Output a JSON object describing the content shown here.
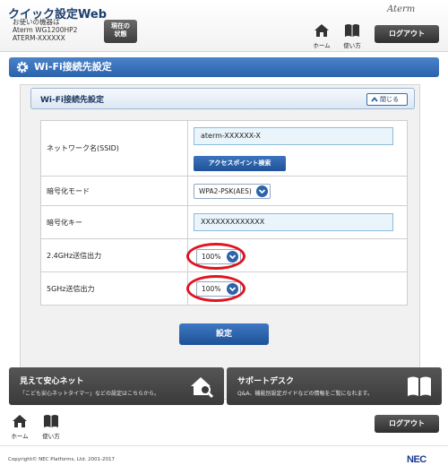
{
  "header": {
    "app_title": "クイック設定Web",
    "device_caption": "お使いの機器は",
    "device_model": "Aterm WG1200HP2",
    "device_name": "ATERM-XXXXXX",
    "status_button_line1": "現在の",
    "status_button_line2": "状態",
    "brand": "Aterm",
    "home_label": "ホーム",
    "help_label": "使い方",
    "logout_label": "ログアウト"
  },
  "main": {
    "title": "Wi-Fi接続先設定",
    "section_title": "Wi-Fi接続先設定",
    "collapse_label": "閉じる",
    "rows": {
      "ssid_label": "ネットワーク名(SSID)",
      "ssid_value": "aterm-XXXXXX-X",
      "ap_search_label": "アクセスポイント検索",
      "enc_mode_label": "暗号化モード",
      "enc_mode_value": "WPA2-PSK(AES)",
      "enc_key_label": "暗号化キー",
      "enc_key_value": "XXXXXXXXXXXXX",
      "power24_label": "2.4GHz送信出力",
      "power24_value": "100%",
      "power5_label": "5GHz送信出力",
      "power5_value": "100%"
    },
    "submit_label": "設定"
  },
  "promos": {
    "left_title": "見えて安心ネット",
    "left_desc": "「こども安心ネットタイマー」などの設定はこちらから。",
    "right_title": "サポートデスク",
    "right_desc": "Q&A、機能別設定ガイドなどの情報をご覧になれます。"
  },
  "footer": {
    "home_label": "ホーム",
    "help_label": "使い方",
    "logout_label": "ログアウト",
    "copyright": "Copyright© NEC Platforms, Ltd. 2001-2017",
    "company": "NEC"
  },
  "colors": {
    "accent_blue": "#2a62ad",
    "highlight_red": "#e0141e",
    "dark_button": "#3d3d3d"
  }
}
